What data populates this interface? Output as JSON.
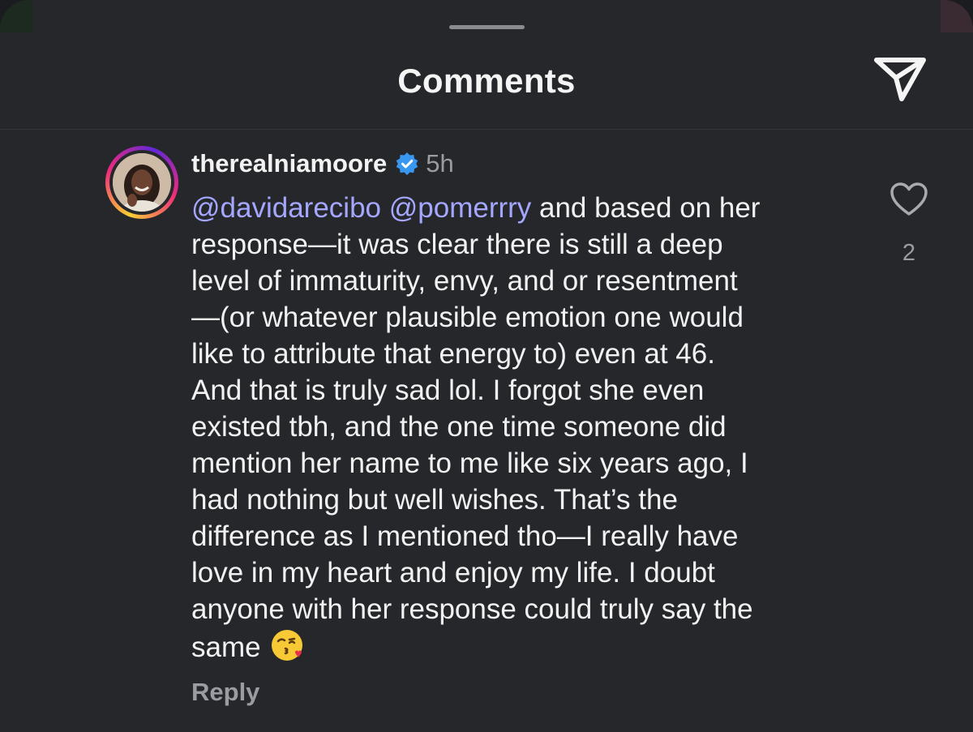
{
  "header": {
    "title": "Comments",
    "send_icon": "paper-plane-icon"
  },
  "comment": {
    "username": "therealniamoore",
    "verified": true,
    "time": "5h",
    "mentions": [
      "@davidarecibo",
      "@pomerrry"
    ],
    "lines": [
      " and based on her",
      "response—it was clear there is still a deep",
      "level of immaturity, envy, and or resentment",
      "—(or whatever plausible emotion one would",
      "like to attribute that energy to) even at 46.",
      "And that is truly sad lol. I forgot she even",
      "existed tbh, and the one time someone did",
      "mention her name to me like six years ago, I",
      "had nothing but well wishes. That’s the",
      "difference as I mentioned tho—I really have",
      "love in my heart and enjoy my life. I doubt",
      "anyone with her response could truly say the",
      "same"
    ],
    "emoji": "kissing-face-with-heart",
    "reply_label": "Reply",
    "like_count": "2"
  },
  "colors": {
    "background": "#25272b",
    "mention": "#a5a7ff",
    "secondary_text": "#9a9ca1",
    "verified_badge": "#3897f0"
  }
}
